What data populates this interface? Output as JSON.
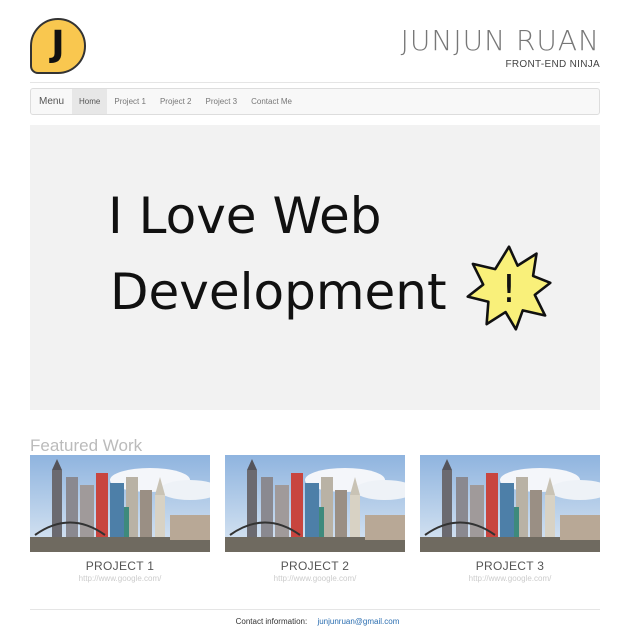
{
  "logo": {
    "letter": "J"
  },
  "header": {
    "title": "JUNJUN RUAN",
    "subtitle": "FRONT-END NINJA"
  },
  "nav": {
    "brand": "Menu",
    "items": [
      "Home",
      "Project 1",
      "Project 2",
      "Project 3",
      "Contact Me"
    ],
    "active": "Home"
  },
  "hero": {
    "line1": "I Love Web",
    "line2": "Development",
    "burst_text": "!"
  },
  "featured": {
    "title": "Featured Work",
    "projects": [
      {
        "name": "PROJECT 1",
        "link": "http://www.google.com/"
      },
      {
        "name": "PROJECT 2",
        "link": "http://www.google.com/"
      },
      {
        "name": "PROJECT 3",
        "link": "http://www.google.com/"
      }
    ]
  },
  "footer": {
    "label": "Contact information:",
    "email": "junjunruan@gmail.com"
  },
  "colors": {
    "logo_bg": "#f9c74f",
    "burst": "#f9f07a",
    "link": "#2a6db0"
  }
}
